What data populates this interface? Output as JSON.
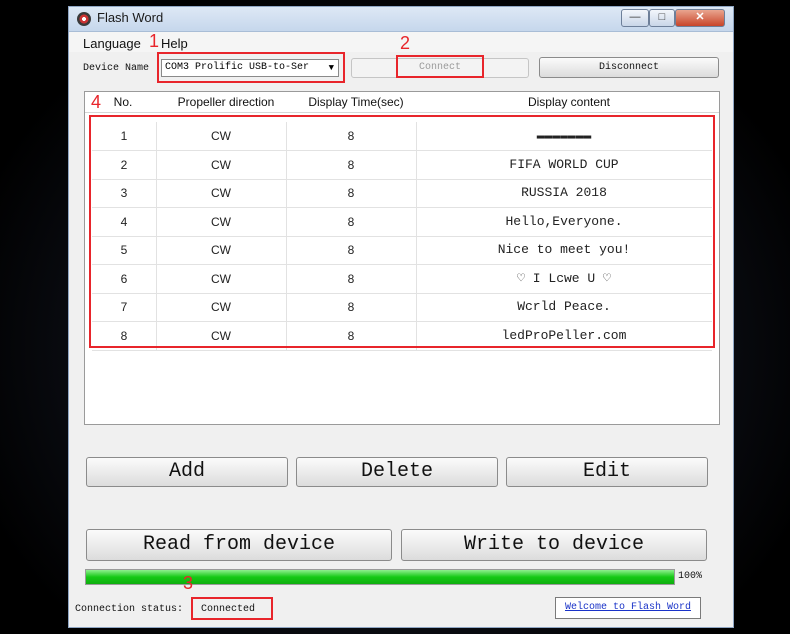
{
  "window": {
    "title": "Flash Word",
    "minimize": "—",
    "maximize": "□",
    "close": "✕"
  },
  "menu": {
    "language": "Language",
    "help": "Help"
  },
  "device": {
    "label": "Device Name",
    "selected": "COM3 Prolific USB-to-Ser",
    "connect": "Connect",
    "disconnect": "Disconnect"
  },
  "annotations": {
    "n1": "1",
    "n2": "2",
    "n3": "3",
    "n4": "4"
  },
  "table": {
    "headers": [
      "No.",
      "Propeller direction",
      "Display Time(sec)",
      "Display content"
    ],
    "rows": [
      [
        "1",
        "CW",
        "8",
        "▬▬▬▬▬▬▬"
      ],
      [
        "2",
        "CW",
        "8",
        "FIFA WORLD CUP"
      ],
      [
        "3",
        "CW",
        "8",
        "RUSSIA 2018"
      ],
      [
        "4",
        "CW",
        "8",
        "Hello,Everyone."
      ],
      [
        "5",
        "CW",
        "8",
        "Nice to meet you!"
      ],
      [
        "6",
        "CW",
        "8",
        "♡ I Lcwe U ♡"
      ],
      [
        "7",
        "CW",
        "8",
        "Wcrld Peace."
      ],
      [
        "8",
        "CW",
        "8",
        "ledProPeller.com"
      ]
    ]
  },
  "buttons": {
    "add": "Add",
    "delete": "Delete",
    "edit": "Edit",
    "read": "Read from device",
    "write": "Write to device"
  },
  "progress": {
    "value": 100,
    "label": "100%"
  },
  "status": {
    "label": "Connection status:",
    "value": "Connected",
    "welcome": "Welcome to Flash Word"
  }
}
